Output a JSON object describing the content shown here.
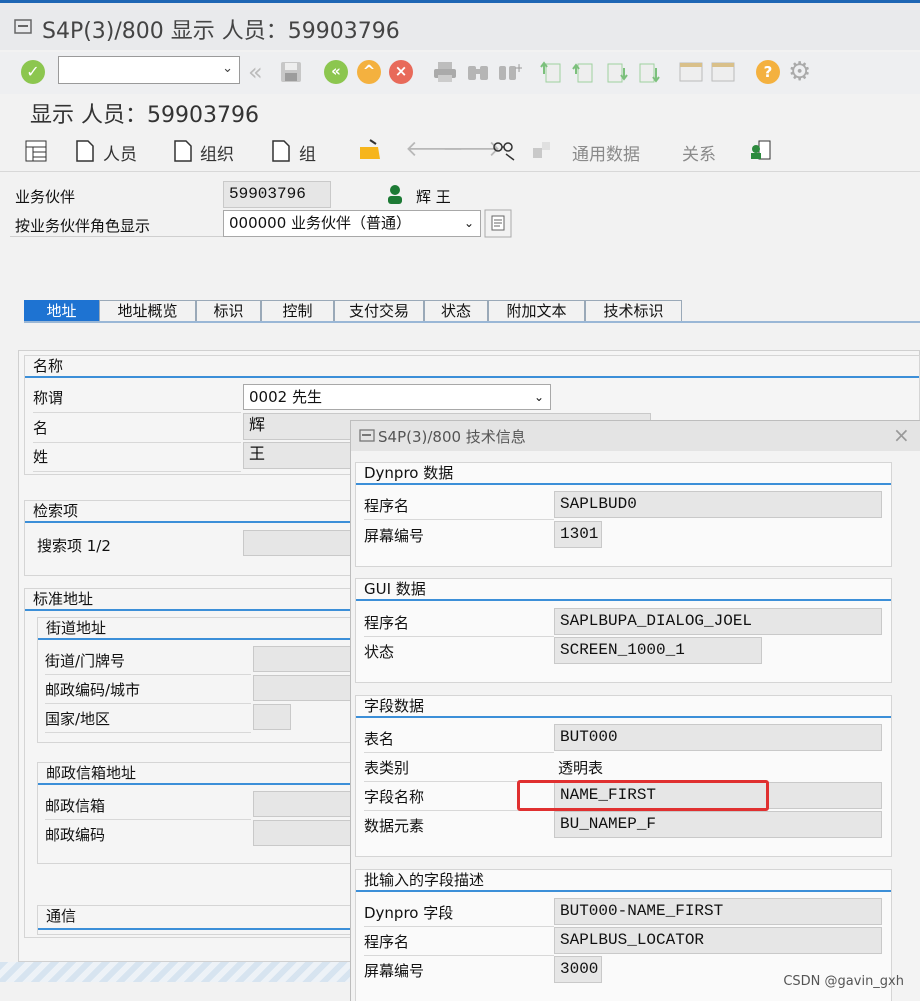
{
  "window": {
    "title": "S4P(3)/800 显示 人员：59903796",
    "subtitle": "显示 人员：59903796"
  },
  "apptoolbar": {
    "person": "人员",
    "org": "组织",
    "group": "组",
    "general_data": "通用数据",
    "relations": "关系"
  },
  "header": {
    "bp_label": "业务伙伴",
    "bp_value": "59903796",
    "bp_name": "辉 王",
    "role_label": "按业务伙伴角色显示",
    "role_value": "000000 业务伙伴（普通）"
  },
  "tabs": [
    "地址",
    "地址概览",
    "标识",
    "控制",
    "支付交易",
    "状态",
    "附加文本",
    "技术标识"
  ],
  "name_group": {
    "title": "名称",
    "title_label": "称谓",
    "title_value": "0002 先生",
    "first_label": "名",
    "first_value": "辉",
    "last_label": "姓",
    "last_value": "王"
  },
  "search_group": {
    "title": "检索项",
    "search1_label": "搜索项 1/2"
  },
  "address_group": {
    "title": "标准地址",
    "street_title": "街道地址",
    "street_label": "街道/门牌号",
    "city_label": "邮政编码/城市",
    "country_label": "国家/地区",
    "pobox_title": "邮政信箱地址",
    "pobox_label": "邮政信箱",
    "pobox_code_label": "邮政编码",
    "comm_title": "通信"
  },
  "dialog": {
    "title": "S4P(3)/800 技术信息",
    "dynpro": {
      "title": "Dynpro 数据",
      "program_label": "程序名",
      "program_value": "SAPLBUD0",
      "screen_label": "屏幕编号",
      "screen_value": "1301"
    },
    "gui": {
      "title": "GUI 数据",
      "program_label": "程序名",
      "program_value": "SAPLBUPA_DIALOG_JOEL",
      "status_label": "状态",
      "status_value": "SCREEN_1000_1"
    },
    "field": {
      "title": "字段数据",
      "table_label": "表名",
      "table_value": "BUT000",
      "tabtype_label": "表类别",
      "tabtype_value": "透明表",
      "fieldname_label": "字段名称",
      "fieldname_value": "NAME_FIRST",
      "dataelem_label": "数据元素",
      "dataelem_value": "BU_NAMEP_F"
    },
    "batch": {
      "title": "批输入的字段描述",
      "dynfield_label": "Dynpro 字段",
      "dynfield_value": "BUT000-NAME_FIRST",
      "program_label": "程序名",
      "program_value": "SAPLBUS_LOCATOR",
      "screen_label": "屏幕编号",
      "screen_value": "3000"
    }
  },
  "watermark": "CSDN @gavin_gxh"
}
